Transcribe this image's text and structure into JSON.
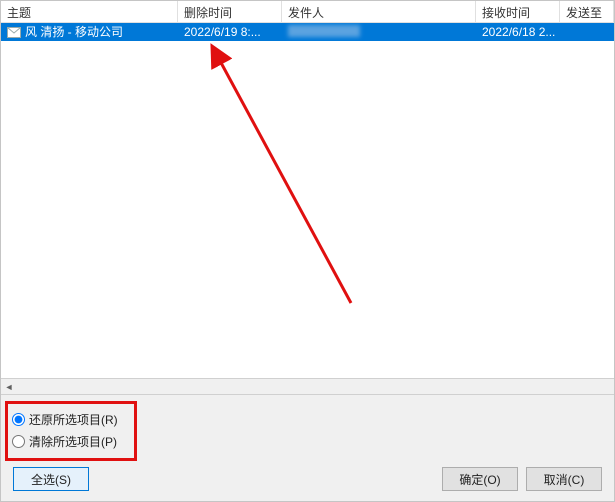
{
  "columns": {
    "subject": "主题",
    "delete_time": "删除时间",
    "sender": "发件人",
    "receive_time": "接收时间",
    "send_to": "发送至"
  },
  "rows": [
    {
      "subject": "风 清扬 - 移动公司",
      "delete_time": "2022/6/19 8:...",
      "sender": "",
      "receive_time": "2022/6/18 2...",
      "send_to": ""
    }
  ],
  "options": {
    "restore": "还原所选项目(R)",
    "purge": "清除所选项目(P)"
  },
  "buttons": {
    "select_all": "全选(S)",
    "ok": "确定(O)",
    "cancel": "取消(C)"
  }
}
